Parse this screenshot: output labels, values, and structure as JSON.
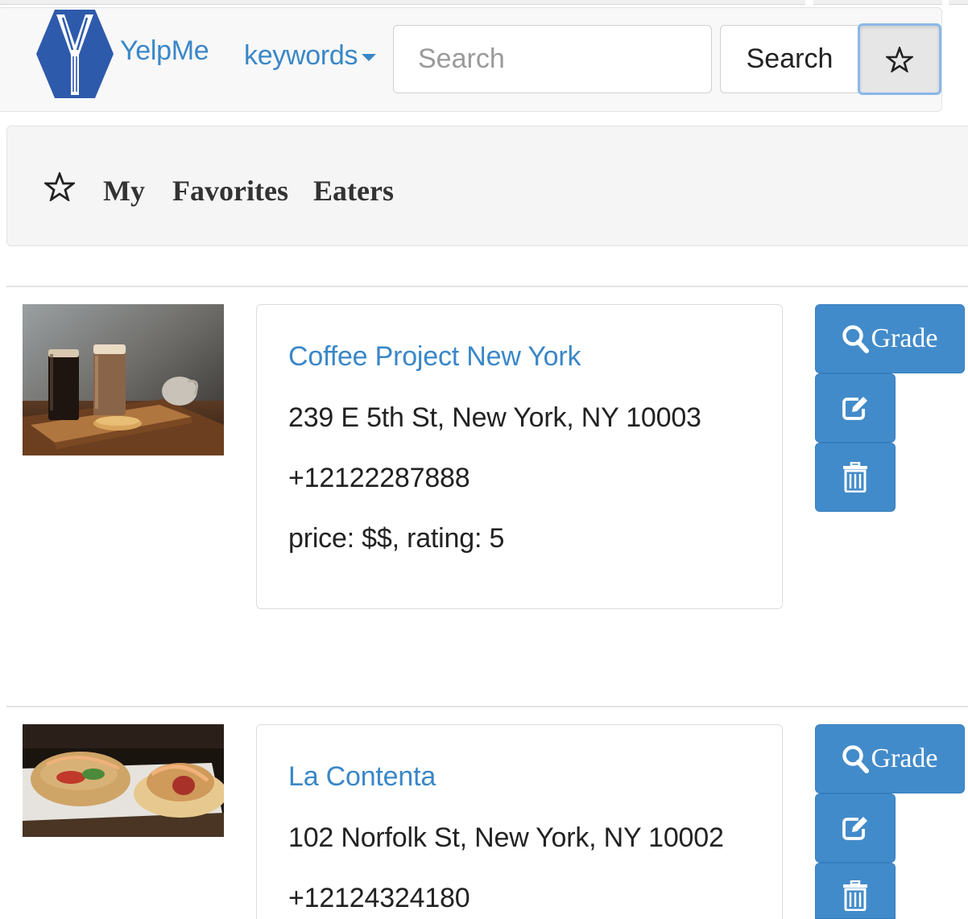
{
  "navbar": {
    "brand": "YelpMe",
    "dropdown_label": "keywords",
    "search_placeholder": "Search",
    "search_button": "Search",
    "favorites_toggle_icon": "star-outline-icon"
  },
  "favorites_header": {
    "icon": "star-outline-icon",
    "words": [
      "My",
      "Favorites",
      "Eaters"
    ]
  },
  "favorites": [
    {
      "name": "Coffee Project New York",
      "address": "239 E 5th St, New York, NY 10003",
      "phone": "+12122287888",
      "details": "price: $$, rating: 5",
      "image": "coffee-photo",
      "actions": {
        "grade": "Grade",
        "grade_icon": "search-icon",
        "edit_icon": "edit-icon",
        "delete_icon": "trash-icon"
      }
    },
    {
      "name": "La Contenta",
      "address": "102 Norfolk St, New York, NY 10002",
      "phone": "+12124324180",
      "image": "tacos-photo",
      "actions": {
        "grade": "Grade",
        "grade_icon": "search-icon",
        "edit_icon": "edit-icon",
        "delete_icon": "trash-icon"
      }
    }
  ],
  "colors": {
    "link": "#3a87c8",
    "primary_button": "#428bca",
    "navbar_bg": "#f8f8f8",
    "panel_bg": "#f5f5f5"
  }
}
